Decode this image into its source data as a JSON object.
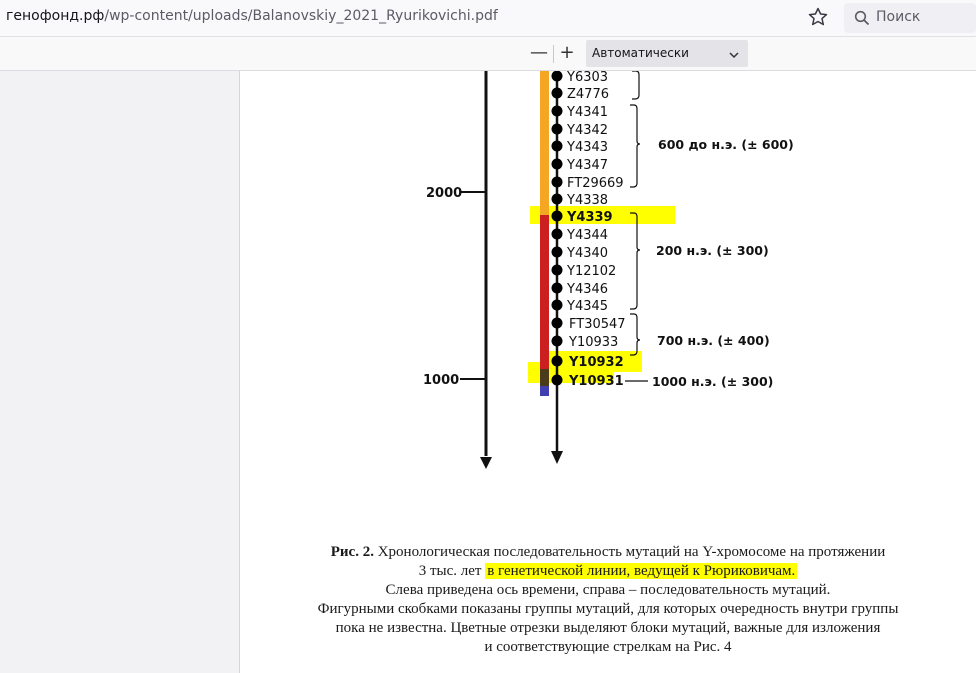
{
  "browser": {
    "url_domain": "генофонд.рф",
    "url_path": "/wp-content/uploads/Balanovskiy_2021_Ryurikovichi.pdf",
    "search_label": "Поиск"
  },
  "pdf_toolbar": {
    "zoom_out_label": "—",
    "zoom_in_label": "+",
    "zoom_value": "Автоматически"
  },
  "figure": {
    "time_labels": [
      "2000",
      "1000"
    ],
    "mutations": [
      "Y6303",
      "Z4776",
      "Y4341",
      "Y4342",
      "Y4343",
      "Y4347",
      "FT29669",
      "Y4338",
      "Y4339",
      "Y4344",
      "Y4340",
      "Y12102",
      "Y4346",
      "Y4345",
      "FT30547",
      "Y10933",
      "Y10932",
      "Y10931"
    ],
    "highlighted_mutations": [
      "Y4339",
      "Y10932",
      "Y10931"
    ],
    "group_labels": [
      "600 до н.э. (± 600)",
      "200 н.э. (± 300)",
      "700 н.э. (± 400)",
      "1000 н.э. (± 300)"
    ],
    "colors": {
      "orange": "#f5a623",
      "red": "#cc1f1f",
      "dark": "#4a3b1a",
      "blue": "#4040b0",
      "highlight": "#ffff00"
    }
  },
  "caption": {
    "line1_prefix": "Рис.  2.",
    "line1_rest": " Хронологическая последовательность мутаций на Y-хромосоме на протяжении",
    "line2_start": "3 тыс. лет ",
    "line2_highlight": "в генетической линии, ведущей к Рюриковичам.",
    "line3": "Слева приведена ось времени, справа – последовательность мутаций.",
    "line4": "Фигурными скобками показаны группы мутаций, для которых очередность внутри группы",
    "line5": "пока не известна. Цветные отрезки выделяют блоки мутаций, важные для изложения",
    "line6": "и соответствующие стрелкам на Рис. 4"
  }
}
